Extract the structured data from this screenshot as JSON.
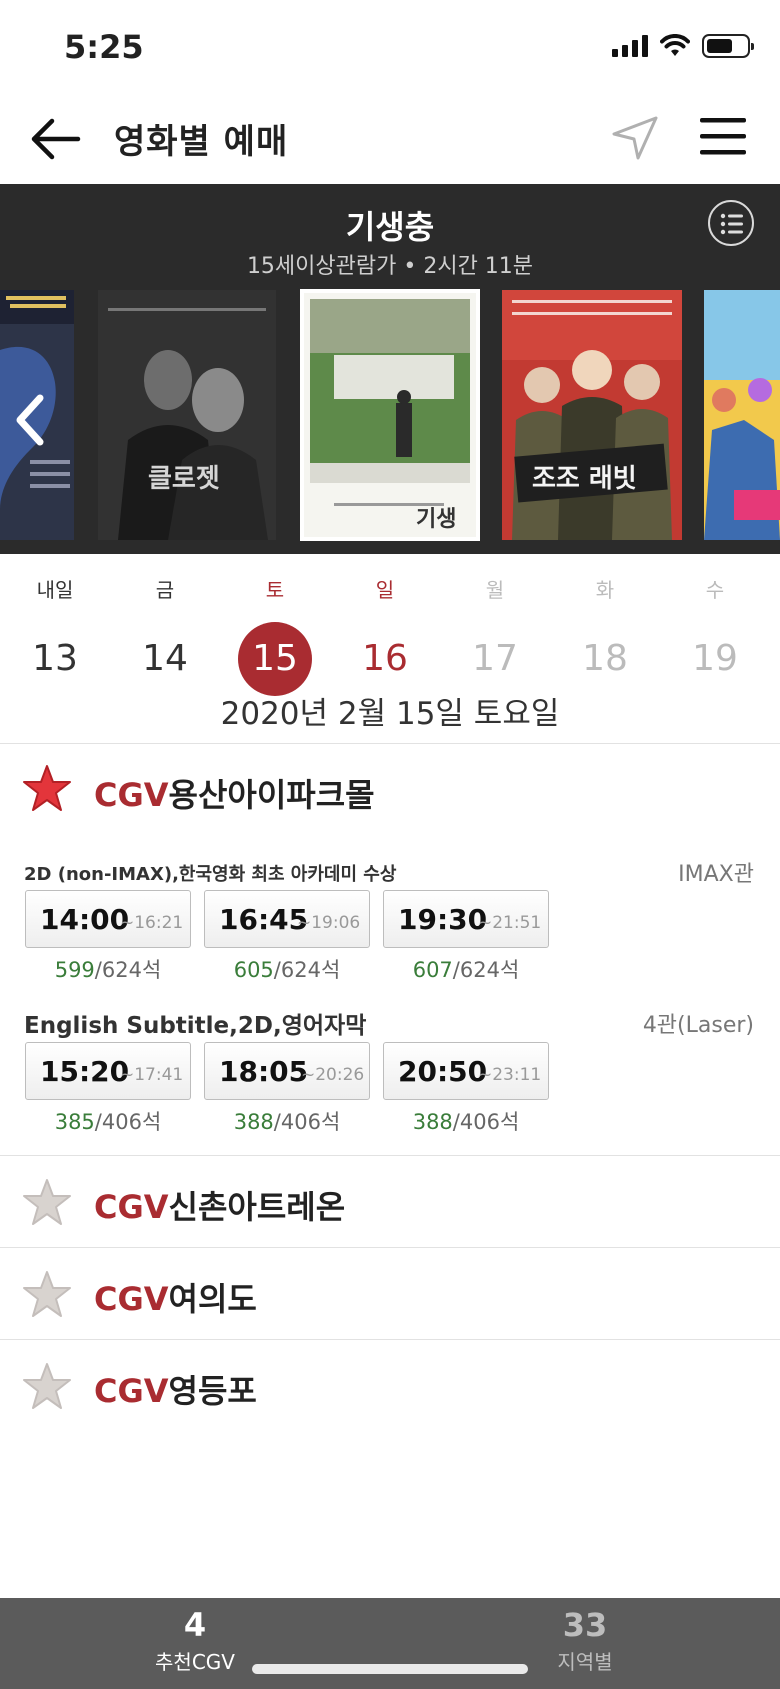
{
  "status_bar": {
    "time": "5:25"
  },
  "navbar": {
    "title": "영화별 예매"
  },
  "movie": {
    "title": "기생충",
    "info": "15세이상관람가 • 2시간 11분",
    "posters": [
      {
        "title": ""
      },
      {
        "title": "클로젯"
      },
      {
        "title": "기생충"
      },
      {
        "title": "조조 래빗"
      },
      {
        "title": ""
      }
    ]
  },
  "dates": {
    "days": [
      {
        "weekday": "내일",
        "day": "13",
        "color": "#333333"
      },
      {
        "weekday": "금",
        "day": "14",
        "color": "#333333"
      },
      {
        "weekday": "토",
        "day": "15",
        "color": "#a92c31"
      },
      {
        "weekday": "일",
        "day": "16",
        "color": "#a92c31"
      },
      {
        "weekday": "월",
        "day": "17",
        "color": "#bbbbbb"
      },
      {
        "weekday": "화",
        "day": "18",
        "color": "#bbbbbb"
      },
      {
        "weekday": "수",
        "day": "19",
        "color": "#bbbbbb"
      }
    ],
    "selected_index": 2,
    "full_date": "2020년 2월 15일 토요일"
  },
  "theaters": [
    {
      "brand": "CGV",
      "name": "용산아이파크몰",
      "favorite": true,
      "screenings": [
        {
          "format": "2D (non-IMAX),한국영화 최초 아카데미 수상",
          "hall": "IMAX관",
          "times": [
            {
              "start": "14:00",
              "end": "~16:21",
              "available": "599",
              "total": "/624석"
            },
            {
              "start": "16:45",
              "end": "~19:06",
              "available": "605",
              "total": "/624석"
            },
            {
              "start": "19:30",
              "end": "~21:51",
              "available": "607",
              "total": "/624석"
            }
          ]
        },
        {
          "format": "English Subtitle,2D,영어자막",
          "hall": "4관(Laser)",
          "times": [
            {
              "start": "15:20",
              "end": "~17:41",
              "available": "385",
              "total": "/406석"
            },
            {
              "start": "18:05",
              "end": "~20:26",
              "available": "388",
              "total": "/406석"
            },
            {
              "start": "20:50",
              "end": "~23:11",
              "available": "388",
              "total": "/406석"
            }
          ]
        }
      ]
    },
    {
      "brand": "CGV",
      "name": "신촌아트레온",
      "favorite": false
    },
    {
      "brand": "CGV",
      "name": "여의도",
      "favorite": false
    },
    {
      "brand": "CGV",
      "name": "영등포",
      "favorite": false
    }
  ],
  "bottom_tabs": [
    {
      "count": "4",
      "label": "추천CGV"
    },
    {
      "count": "33",
      "label": "지역별"
    }
  ],
  "colors": {
    "accent": "#a92c31",
    "available_seats": "#3a7d3a",
    "header_bg": "#2b2b2b"
  }
}
